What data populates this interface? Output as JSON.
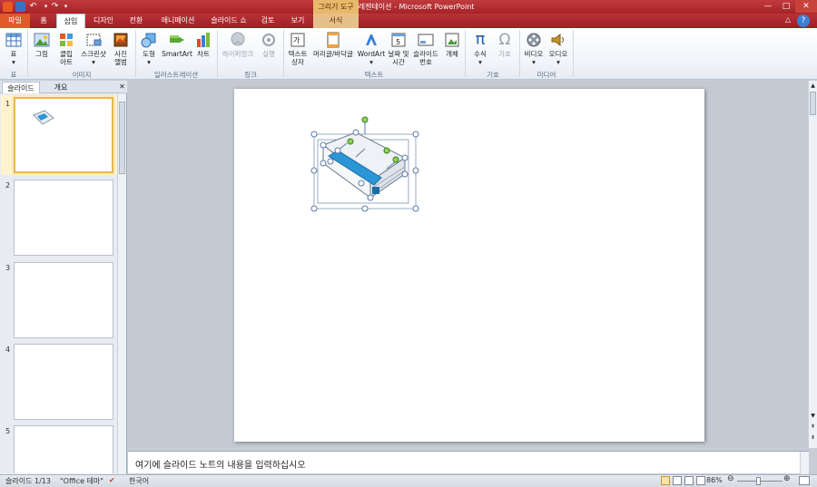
{
  "window": {
    "title": "새 프레젠테이션 - Microsoft PowerPoint",
    "context_group": "그리기 도구",
    "controls": {
      "minimize": "—",
      "maximize": "□",
      "close": "✕"
    }
  },
  "tabs": [
    {
      "label": "파일"
    },
    {
      "label": "홈"
    },
    {
      "label": "삽입"
    },
    {
      "label": "디자인"
    },
    {
      "label": "전환"
    },
    {
      "label": "애니메이션"
    },
    {
      "label": "슬라이드 쇼"
    },
    {
      "label": "검토"
    },
    {
      "label": "보기"
    },
    {
      "label": "서식"
    }
  ],
  "ribbon": {
    "groups": {
      "table": "표",
      "images": "이미지",
      "illustrations": "일러스트레이션",
      "links": "링크",
      "text": "텍스트",
      "symbols": "기호",
      "media": "미디어"
    },
    "buttons": {
      "table": "표",
      "picture": "그림",
      "clipart_1": "클립",
      "clipart_2": "아트",
      "screenshot": "스크린샷",
      "album_1": "사진",
      "album_2": "앨범",
      "shapes": "도형",
      "smartart": "SmartArt",
      "chart": "차트",
      "hyperlink": "하이퍼링크",
      "action": "실행",
      "textbox_1": "텍스트",
      "textbox_2": "상자",
      "header_footer": "머리글/바닥글",
      "wordart": "WordArt",
      "datetime_1": "날짜 및",
      "datetime_2": "시간",
      "slidenum_1": "슬라이드",
      "slidenum_2": "번호",
      "object": "개체",
      "equation": "수식",
      "symbol": "기호",
      "video": "비디오",
      "audio": "오디오"
    }
  },
  "left_pane": {
    "tabs": [
      "슬라이드",
      "개요"
    ],
    "thumbnails": [
      "1",
      "2",
      "3",
      "4",
      "5"
    ]
  },
  "notes_placeholder": "여기에 슬라이드 노트의 내용을 입력하십시오",
  "status": {
    "slide": "슬라이드 1/13",
    "theme": "\"Office 테마\"",
    "language": "한국어",
    "zoom": "86%"
  },
  "colors": {
    "title_red": "#b0282c",
    "accent_blue": "#2b96d6",
    "handle_green": "#8fd35a"
  }
}
